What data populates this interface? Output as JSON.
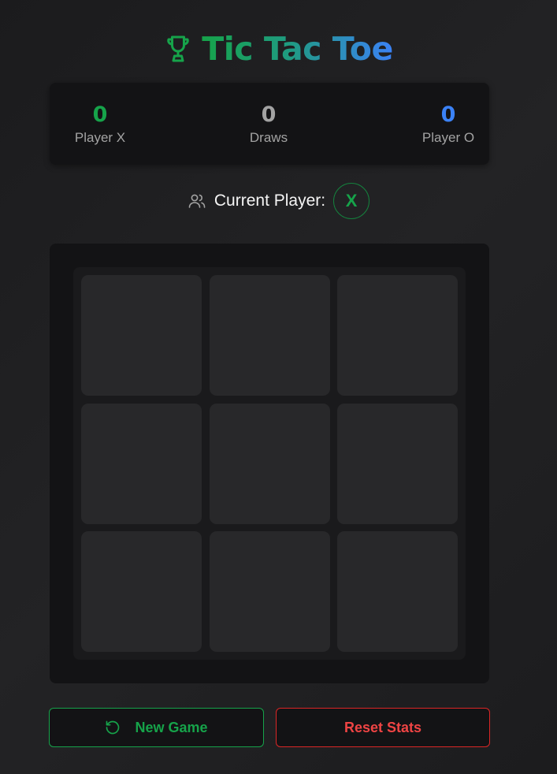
{
  "header": {
    "title": "Tic Tac Toe",
    "icon": "trophy-icon"
  },
  "scores": {
    "x": {
      "value": "0",
      "label": "Player X"
    },
    "draws": {
      "value": "0",
      "label": "Draws"
    },
    "o": {
      "value": "0",
      "label": "Player O"
    }
  },
  "status": {
    "icon": "users-icon",
    "label": "Current Player:",
    "player": "X"
  },
  "board": {
    "cells": [
      "",
      "",
      "",
      "",
      "",
      "",
      "",
      "",
      ""
    ]
  },
  "actions": {
    "new_game": "New Game",
    "new_game_icon": "rotate-ccw-icon",
    "reset_stats": "Reset Stats"
  },
  "colors": {
    "x": "#16a34a",
    "o": "#3b82f6",
    "draw": "#a3a3a3",
    "danger": "#ef4444"
  }
}
